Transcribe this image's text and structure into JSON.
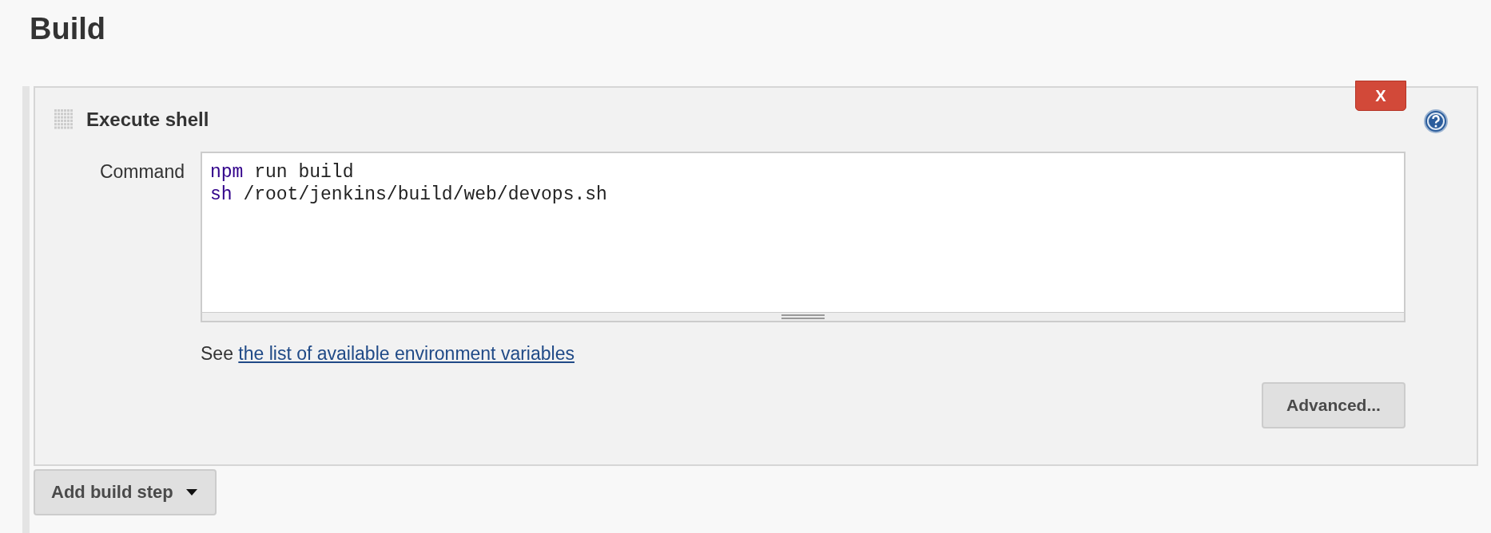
{
  "section_title": "Build",
  "build_step": {
    "title": "Execute shell",
    "delete_button": "X",
    "field_label": "Command",
    "command_lines": [
      {
        "keyword": "npm",
        "rest": " run build"
      },
      {
        "keyword": "sh",
        "rest": " /root/jenkins/build/web/devops.sh"
      }
    ],
    "hint_text": "See",
    "hint_link": "the list of available environment variables",
    "advanced_button": "Advanced..."
  },
  "add_button": "Add build step"
}
